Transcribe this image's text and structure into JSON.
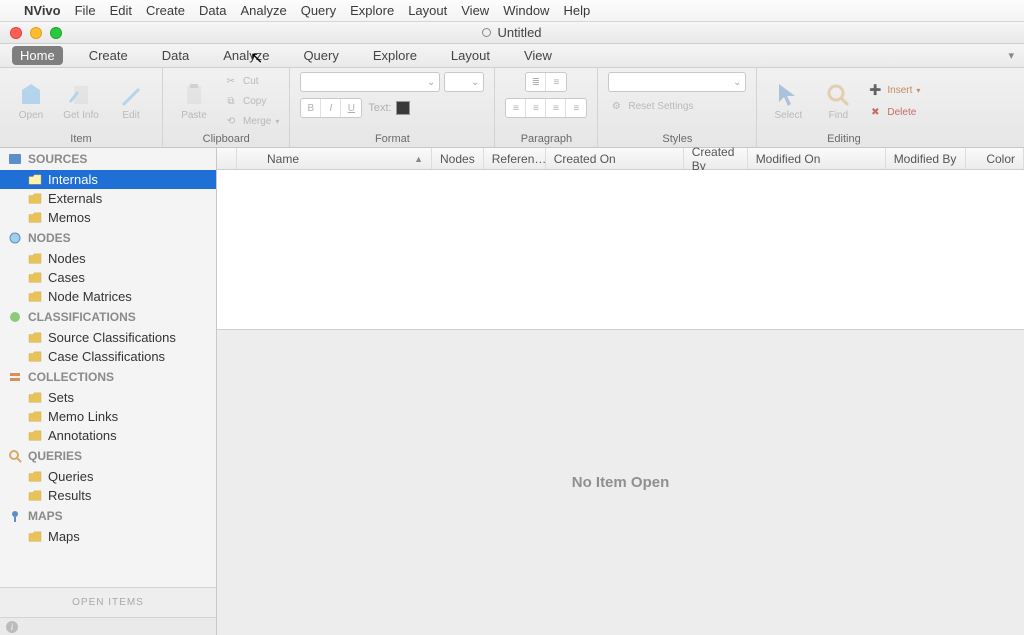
{
  "mac_menu": {
    "app": "NVivo",
    "items": [
      "File",
      "Edit",
      "Create",
      "Data",
      "Analyze",
      "Query",
      "Explore",
      "Layout",
      "View",
      "Window",
      "Help"
    ]
  },
  "window": {
    "title": "Untitled"
  },
  "ribbon_tabs": [
    "Home",
    "Create",
    "Data",
    "Analyze",
    "Query",
    "Explore",
    "Layout",
    "View"
  ],
  "ribbon_tabs_active": "Home",
  "ribbon": {
    "item": {
      "open": "Open",
      "getinfo": "Get Info",
      "edit": "Edit",
      "label": "Item"
    },
    "clipboard": {
      "paste": "Paste",
      "cut": "Cut",
      "copy": "Copy",
      "merge": "Merge",
      "label": "Clipboard"
    },
    "format": {
      "b": "B",
      "i": "I",
      "u": "U",
      "text": "Text:",
      "label": "Format"
    },
    "paragraph": {
      "label": "Paragraph"
    },
    "styles": {
      "reset": "Reset Settings",
      "label": "Styles"
    },
    "editing": {
      "select": "Select",
      "find": "Find",
      "insert": "Insert",
      "delete": "Delete",
      "label": "Editing"
    }
  },
  "sidebar": {
    "sections": [
      {
        "title": "SOURCES",
        "icon": "book",
        "items": [
          "Internals",
          "Externals",
          "Memos"
        ],
        "selected": "Internals"
      },
      {
        "title": "NODES",
        "icon": "circle",
        "items": [
          "Nodes",
          "Cases",
          "Node Matrices"
        ]
      },
      {
        "title": "CLASSIFICATIONS",
        "icon": "gear",
        "items": [
          "Source Classifications",
          "Case Classifications"
        ]
      },
      {
        "title": "COLLECTIONS",
        "icon": "stack",
        "items": [
          "Sets",
          "Memo Links",
          "Annotations"
        ]
      },
      {
        "title": "QUERIES",
        "icon": "search",
        "items": [
          "Queries",
          "Results"
        ]
      },
      {
        "title": "MAPS",
        "icon": "pin",
        "items": [
          "Maps"
        ]
      }
    ],
    "open_items": "OPEN ITEMS"
  },
  "columns": {
    "name": "Name",
    "nodes": "Nodes",
    "references": "Referen…",
    "created_on": "Created On",
    "created_by": "Created By",
    "modified_on": "Modified On",
    "modified_by": "Modified By",
    "color": "Color"
  },
  "detail": {
    "empty": "No Item Open"
  }
}
